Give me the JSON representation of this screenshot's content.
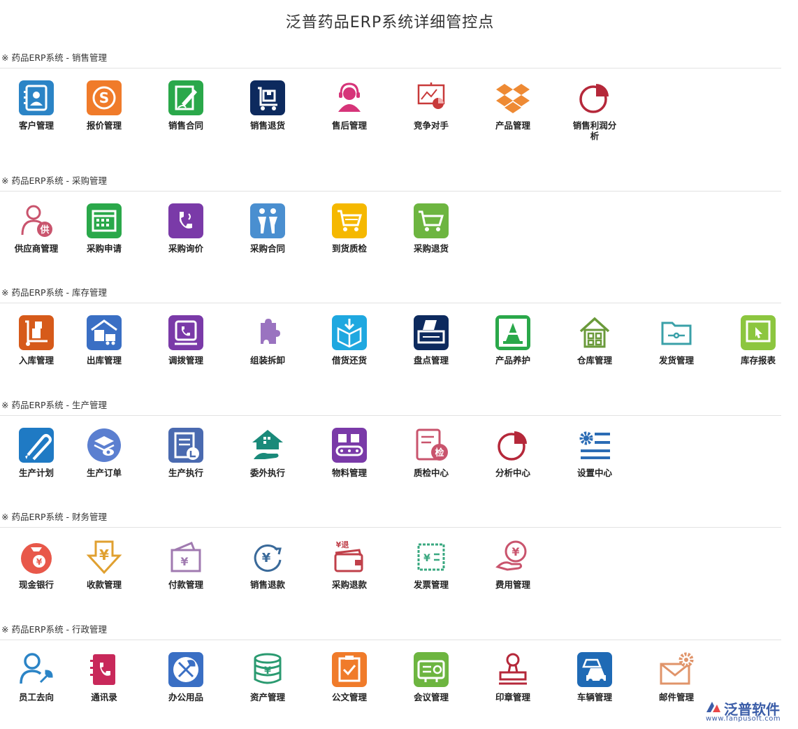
{
  "page_title": "泛普药品ERP系统详细管控点",
  "sections": [
    {
      "header": "※ 药品ERP系统 - 销售管理",
      "items": [
        {
          "label": "客户管理",
          "icon": "customer-card-icon",
          "color": "#2b84c6"
        },
        {
          "label": "报价管理",
          "icon": "skype-icon",
          "color": "#f07b2a"
        },
        {
          "label": "销售合同",
          "icon": "contract-sign-icon",
          "color": "#2aa84a"
        },
        {
          "label": "销售退货",
          "icon": "return-cart-icon",
          "color": "#0d2a5e"
        },
        {
          "label": "售后管理",
          "icon": "support-agent-icon",
          "color": "#d63479"
        },
        {
          "label": "竞争对手",
          "icon": "presentation-chart-icon",
          "color": "#c83a3a"
        },
        {
          "label": "产品管理",
          "icon": "dropbox-icon",
          "color": "#ee8a34"
        },
        {
          "label": "销售利润分析",
          "icon": "pie-chart-icon",
          "color": "#b5283a"
        }
      ]
    },
    {
      "header": "※ 药品ERP系统 - 采购管理",
      "items": [
        {
          "label": "供应商管理",
          "icon": "supplier-user-icon",
          "color": "#c9546d"
        },
        {
          "label": "采购申请",
          "icon": "calendar-icon",
          "color": "#2aa84a"
        },
        {
          "label": "采购询价",
          "icon": "phone-icon",
          "color": "#7a3aa8"
        },
        {
          "label": "采购合同",
          "icon": "handshake-people-icon",
          "color": "#4a8fd0"
        },
        {
          "label": "到货质检",
          "icon": "shopping-cart-icon",
          "color": "#f5b800"
        },
        {
          "label": "采购退货",
          "icon": "cart-return-icon",
          "color": "#6db540"
        }
      ]
    },
    {
      "header": "※ 药品ERP系统 - 库存管理",
      "items": [
        {
          "label": "入库管理",
          "icon": "hand-truck-icon",
          "color": "#d65a1a"
        },
        {
          "label": "出库管理",
          "icon": "warehouse-truck-icon",
          "color": "#3a6fc4"
        },
        {
          "label": "调拨管理",
          "icon": "transfer-phone-icon",
          "color": "#7a3aa8"
        },
        {
          "label": "组装拆卸",
          "icon": "puzzle-icon",
          "color": "#9a73c0"
        },
        {
          "label": "借货还货",
          "icon": "box-download-icon",
          "color": "#1fa8e0"
        },
        {
          "label": "盘点管理",
          "icon": "scanner-icon",
          "color": "#0d2a5e"
        },
        {
          "label": "产品养护",
          "icon": "cone-icon",
          "color": "#2aa84a"
        },
        {
          "label": "仓库管理",
          "icon": "house-grid-icon",
          "color": "#6a9a3a"
        },
        {
          "label": "发货管理",
          "icon": "folder-icon",
          "color": "#3aa0a8"
        },
        {
          "label": "库存报表",
          "icon": "cursor-screen-icon",
          "color": "#8cc63f"
        }
      ]
    },
    {
      "header": "※ 药品ERP系统 - 生产管理",
      "items": [
        {
          "label": "生产计划",
          "icon": "paperclip-icon",
          "color": "#1f7ac4"
        },
        {
          "label": "生产订单",
          "icon": "layers-eye-icon",
          "color": "#5b7fd0"
        },
        {
          "label": "生产执行",
          "icon": "clipboard-hand-icon",
          "color": "#4a6ab0"
        },
        {
          "label": "委外执行",
          "icon": "house-hand-icon",
          "color": "#1a8a7a"
        },
        {
          "label": "物料管理",
          "icon": "conveyor-icon",
          "color": "#7a3aa8"
        },
        {
          "label": "质检中心",
          "icon": "inspect-document-icon",
          "color": "#c9546d"
        },
        {
          "label": "分析中心",
          "icon": "pie-analysis-icon",
          "color": "#b5283a"
        },
        {
          "label": "设置中心",
          "icon": "gear-settings-icon",
          "color": "#2b6cb5"
        }
      ]
    },
    {
      "header": "※ 药品ERP系统 - 财务管理",
      "items": [
        {
          "label": "现金银行",
          "icon": "money-bag-icon",
          "color": "#e8584a"
        },
        {
          "label": "收款管理",
          "icon": "yuan-arrow-down-icon",
          "color": "#e0a030"
        },
        {
          "label": "付款管理",
          "icon": "wallet-yuan-icon",
          "color": "#a07ab0"
        },
        {
          "label": "销售退款",
          "icon": "yuan-refresh-icon",
          "color": "#3a6a9a"
        },
        {
          "label": "采购退款",
          "icon": "wallet-refund-icon",
          "color": "#c0404a"
        },
        {
          "label": "发票管理",
          "icon": "invoice-icon",
          "color": "#3aa880"
        },
        {
          "label": "费用管理",
          "icon": "hand-coin-icon",
          "color": "#c9546d"
        }
      ]
    },
    {
      "header": "※ 药品ERP系统 - 行政管理",
      "items": [
        {
          "label": "员工去向",
          "icon": "user-wrench-icon",
          "color": "#2b84c6"
        },
        {
          "label": "通讯录",
          "icon": "address-book-icon",
          "color": "#c8285a"
        },
        {
          "label": "办公用品",
          "icon": "tools-icon",
          "color": "#3a6fc4"
        },
        {
          "label": "资产管理",
          "icon": "coins-stack-icon",
          "color": "#2a9a70"
        },
        {
          "label": "公文管理",
          "icon": "document-check-icon",
          "color": "#f07b2a"
        },
        {
          "label": "会议管理",
          "icon": "projector-icon",
          "color": "#6db540"
        },
        {
          "label": "印章管理",
          "icon": "stamp-icon",
          "color": "#b5283a"
        },
        {
          "label": "车辆管理",
          "icon": "cars-icon",
          "color": "#1f6ab5"
        },
        {
          "label": "邮件管理",
          "icon": "mail-gear-icon",
          "color": "#e0946a"
        }
      ]
    }
  ],
  "footer_logo": {
    "brand": "泛普软件",
    "url": "www.fanpusoft.com",
    "color": "#3b5da8"
  }
}
